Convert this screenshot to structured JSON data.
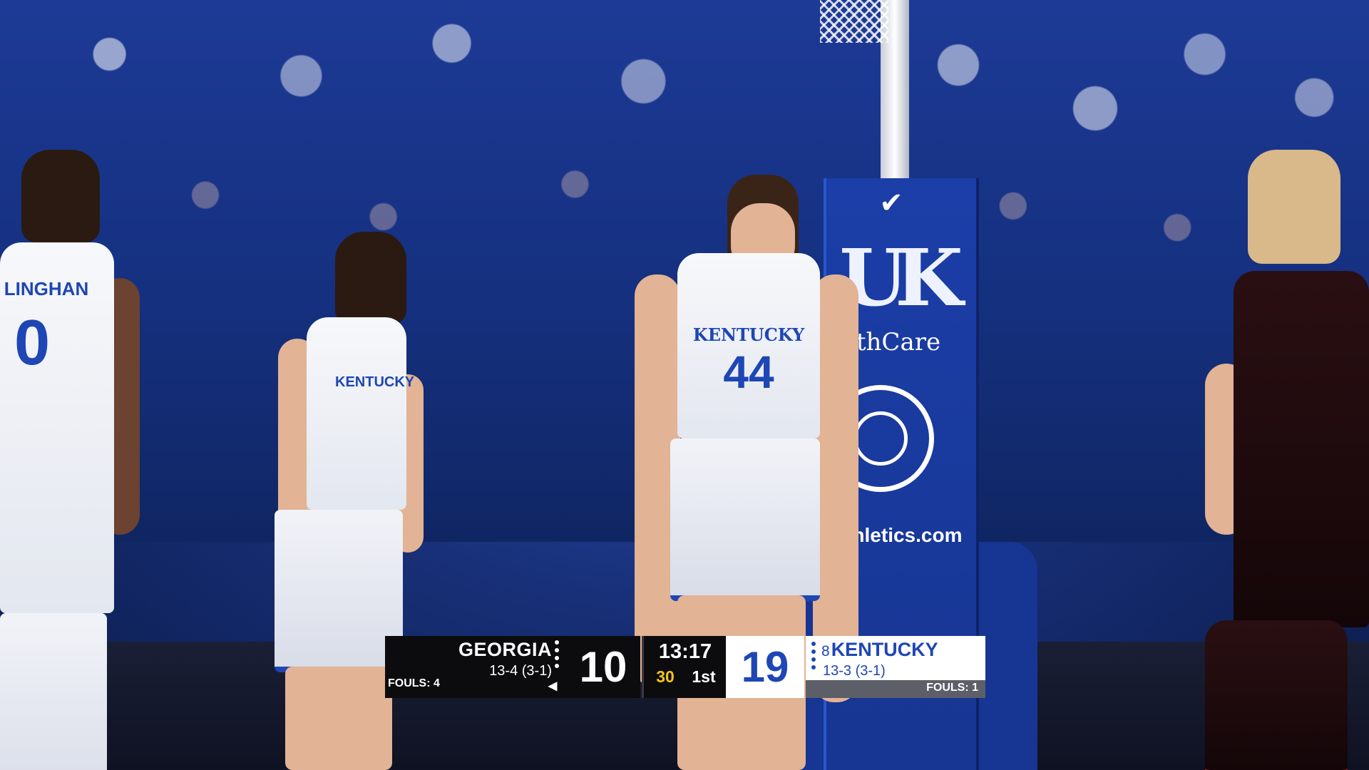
{
  "scoreboard": {
    "away": {
      "name": "GEORGIA",
      "record": "13-4 (3-1)",
      "fouls": "FOULS: 4",
      "score": "10",
      "possession_icon": "possession-arrow-icon"
    },
    "clock": {
      "game_clock": "13:17",
      "shot_clock": "30",
      "period": "1st"
    },
    "home": {
      "rank": "8",
      "name": "KENTUCKY",
      "record": "13-3 (3-1)",
      "fouls": "FOULS: 1",
      "score": "19"
    },
    "colors": {
      "home_accent": "#1e46b4",
      "shot_clock": "#f2c518",
      "away_bg": "#0c0c0e"
    }
  },
  "scene": {
    "stanchion_pad": {
      "logo": "UK",
      "text_top": "thCare",
      "text_bottom": "athletics.com"
    },
    "players": {
      "left_player_number": "0",
      "left_player_name": "LINGHAN",
      "center_player_number": "44",
      "center_player_team": "KENTUCKY",
      "second_player_team": "KENTUCKY"
    }
  }
}
